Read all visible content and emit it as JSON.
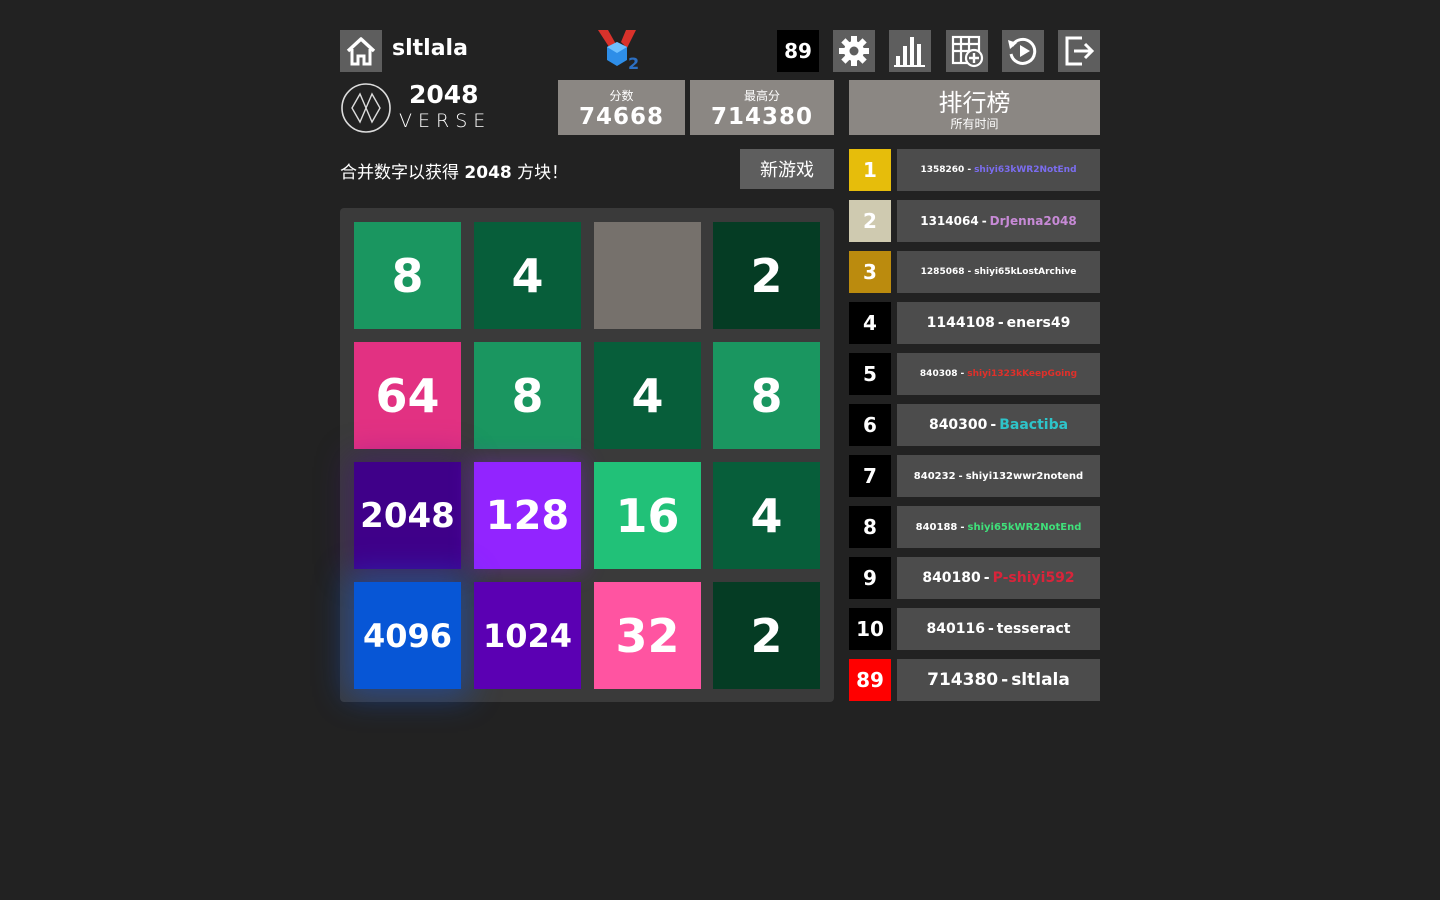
{
  "header": {
    "username": "sltlala",
    "rank": "89",
    "icons": [
      "home-icon",
      "medal-icon",
      "gear-icon",
      "bar-chart-icon",
      "grid-add-icon",
      "replay-icon",
      "logout-icon"
    ]
  },
  "logo": {
    "title": "2048",
    "subtitle": "VERSE"
  },
  "scores": {
    "score_label": "分数",
    "score_value": "74668",
    "best_label": "最高分",
    "best_value": "714380"
  },
  "intro": {
    "prefix": "合并数字以获得 ",
    "target": "2048",
    "suffix": " 方块！"
  },
  "new_game_label": "新游戏",
  "leaderboard": {
    "title": "排行榜",
    "subtitle": "所有时间",
    "entries": [
      {
        "rank": "1",
        "score": "1358260",
        "name": "shiyi63kWR2NotEnd",
        "rank_color": "#e6bd0b",
        "name_color": "#7b6df0",
        "size": 9
      },
      {
        "rank": "2",
        "score": "1314064",
        "name": "DrJenna2048",
        "rank_color": "#cfcab0",
        "name_color": "#c78ad6",
        "size": 12
      },
      {
        "rank": "3",
        "score": "1285068",
        "name": "shiyi65kLostArchive",
        "rank_color": "#bb8b0e",
        "name_color": "#ffffff",
        "size": 9
      },
      {
        "rank": "4",
        "score": "1144108",
        "name": "eners49",
        "rank_color": "#000000",
        "name_color": "#ffffff",
        "size": 14
      },
      {
        "rank": "5",
        "score": "840308",
        "name": "shiyi1323kKeepGoing",
        "rank_color": "#000000",
        "name_color": "#e0302a",
        "size": 9
      },
      {
        "rank": "6",
        "score": "840300",
        "name": "Baactiba",
        "rank_color": "#000000",
        "name_color": "#2ec4c9",
        "size": 14
      },
      {
        "rank": "7",
        "score": "840232",
        "name": "shiyi132wwr2notend",
        "rank_color": "#000000",
        "name_color": "#ffffff",
        "size": 10
      },
      {
        "rank": "8",
        "score": "840188",
        "name": "shiyi65kWR2NotEnd",
        "rank_color": "#000000",
        "name_color": "#3fe07a",
        "size": 10
      },
      {
        "rank": "9",
        "score": "840180",
        "name": "P-shiyi592",
        "rank_color": "#000000",
        "name_color": "#d9243a",
        "size": 14
      },
      {
        "rank": "10",
        "score": "840116",
        "name": "tesseract",
        "rank_color": "#000000",
        "name_color": "#ffffff",
        "size": 14
      },
      {
        "rank": "89",
        "score": "714380",
        "name": "sltlala",
        "rank_color": "#ff0000",
        "name_color": "#ffffff",
        "size": 17
      }
    ]
  },
  "board": {
    "tiles": [
      {
        "value": "8",
        "color": "#1a9660",
        "size": 46
      },
      {
        "value": "4",
        "color": "#075e3a",
        "size": 46
      },
      {
        "value": "",
        "color": "#76716c",
        "size": 46
      },
      {
        "value": "2",
        "color": "#053c24",
        "size": 46
      },
      {
        "value": "64",
        "color": "#e23182",
        "size": 46
      },
      {
        "value": "8",
        "color": "#1a9660",
        "size": 46
      },
      {
        "value": "4",
        "color": "#075e3a",
        "size": 46
      },
      {
        "value": "8",
        "color": "#1a9660",
        "size": 46
      },
      {
        "value": "2048",
        "color": "#3f0089",
        "size": 34
      },
      {
        "value": "128",
        "color": "#9224ff",
        "size": 40
      },
      {
        "value": "16",
        "color": "#21c178",
        "size": 46
      },
      {
        "value": "4",
        "color": "#075e3a",
        "size": 46
      },
      {
        "value": "4096",
        "color": "#0756d6",
        "size": 32
      },
      {
        "value": "1024",
        "color": "#5b00b3",
        "size": 32
      },
      {
        "value": "32",
        "color": "#ff54a1",
        "size": 46
      },
      {
        "value": "2",
        "color": "#053c24",
        "size": 46
      }
    ]
  }
}
